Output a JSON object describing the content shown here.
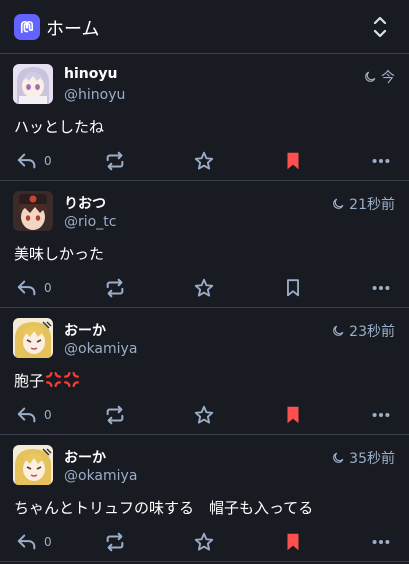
{
  "header": {
    "title": "ホーム"
  },
  "colors": {
    "background": "#191b22",
    "muted": "#9baec8",
    "bookmark_active": "#ff5050",
    "brand": "#6364ff"
  },
  "posts": [
    {
      "display_name": "hinoyu",
      "handle": "@hinoyu",
      "time": "今",
      "content": "ハッとしたね",
      "reply_count": "0",
      "bookmarked": true
    },
    {
      "display_name": "りおつ",
      "handle": "@rio_tc",
      "time": "21秒前",
      "content": "美味しかった",
      "reply_count": "0",
      "bookmarked": false
    },
    {
      "display_name": "おーか",
      "handle": "@okamiya",
      "time": "23秒前",
      "content": "胞子",
      "content_emoji": [
        "anger-emoji",
        "anger-emoji"
      ],
      "reply_count": "0",
      "bookmarked": true
    },
    {
      "display_name": "おーか",
      "handle": "@okamiya",
      "time": "35秒前",
      "content": "ちゃんとトリュフの味する　帽子も入ってる",
      "reply_count": "0",
      "bookmarked": true
    }
  ]
}
